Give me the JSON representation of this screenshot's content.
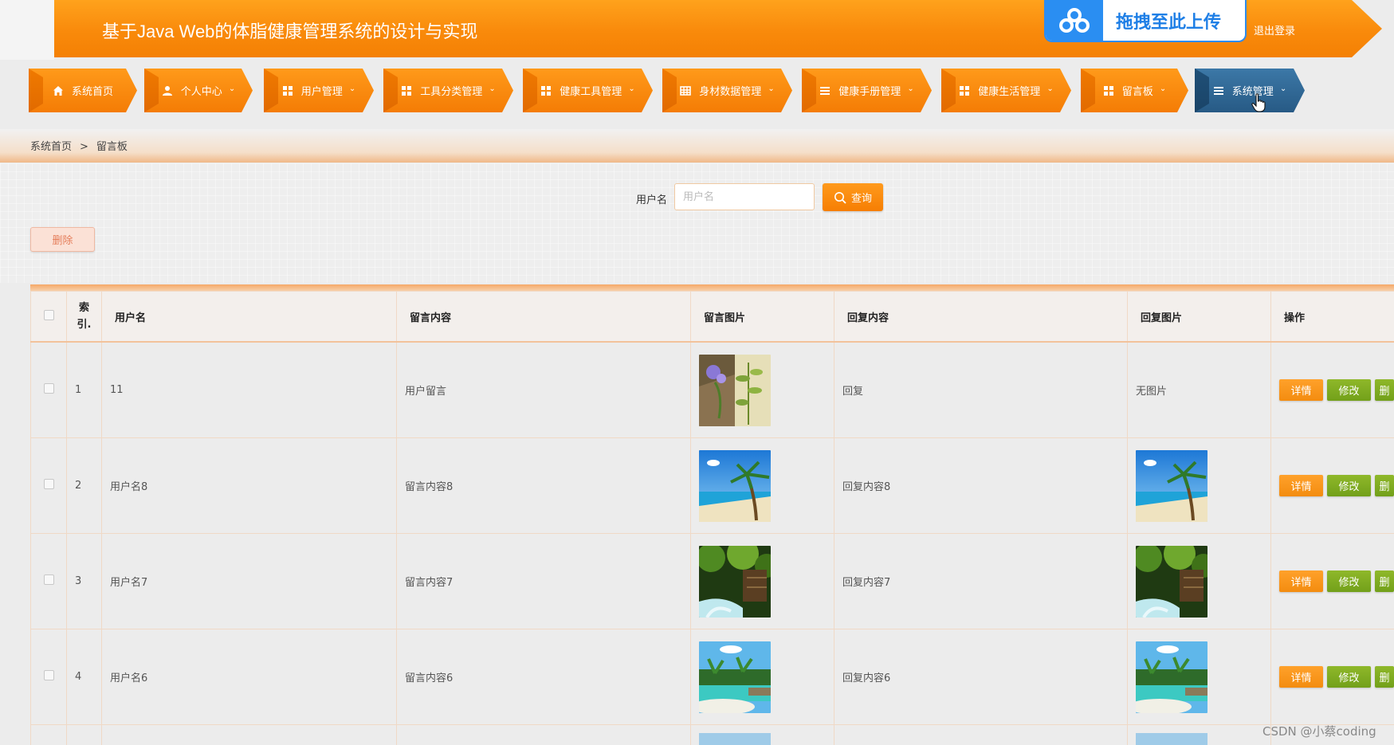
{
  "header": {
    "title": "基于Java Web的体脂健康管理系统的设计与实现",
    "upload_text": "拖拽至此上传",
    "logout": "退出登录"
  },
  "nav": {
    "items": [
      {
        "label": "系统首页",
        "icon": "home-icon",
        "dropdown": false
      },
      {
        "label": "个人中心",
        "icon": "user-icon",
        "dropdown": true
      },
      {
        "label": "用户管理",
        "icon": "grid-icon",
        "dropdown": true
      },
      {
        "label": "工具分类管理",
        "icon": "grid-icon",
        "dropdown": true
      },
      {
        "label": "健康工具管理",
        "icon": "grid-icon",
        "dropdown": true
      },
      {
        "label": "身材数据管理",
        "icon": "table-icon",
        "dropdown": true
      },
      {
        "label": "健康手册管理",
        "icon": "list-icon",
        "dropdown": true
      },
      {
        "label": "健康生活管理",
        "icon": "grid-icon",
        "dropdown": true
      },
      {
        "label": "留言板",
        "icon": "grid-icon",
        "dropdown": true
      },
      {
        "label": "系统管理",
        "icon": "list-icon",
        "dropdown": true,
        "active": true
      }
    ],
    "active_color": "#2f6a98",
    "accent_color": "#f7890a"
  },
  "breadcrumb": {
    "home": "系统首页",
    "separator": ">",
    "current": "留言板"
  },
  "search": {
    "label": "用户名",
    "placeholder": "用户名",
    "value": "",
    "button": "查询"
  },
  "toolbar": {
    "delete_label": "删除"
  },
  "table": {
    "headers": {
      "index": "索\n引.",
      "username": "用户名",
      "content": "留言内容",
      "image": "留言图片",
      "reply": "回复内容",
      "reply_image": "回复图片",
      "ops": "操作"
    },
    "rows": [
      {
        "index": "1",
        "username": "11",
        "content": "用户留言",
        "image": "flowers-photo",
        "reply": "回复",
        "reply_image_text": "无图片",
        "reply_image": ""
      },
      {
        "index": "2",
        "username": "用户名8",
        "content": "留言内容8",
        "image": "beach-palm-photo",
        "reply": "回复内容8",
        "reply_image_text": "",
        "reply_image": "beach-palm-photo"
      },
      {
        "index": "3",
        "username": "用户名7",
        "content": "留言内容7",
        "image": "waterfall-forest-photo",
        "reply": "回复内容7",
        "reply_image_text": "",
        "reply_image": "waterfall-forest-photo"
      },
      {
        "index": "4",
        "username": "用户名6",
        "content": "留言内容6",
        "image": "tropical-lagoon-photo",
        "reply": "回复内容6",
        "reply_image_text": "",
        "reply_image": "tropical-lagoon-photo"
      }
    ],
    "ops": {
      "detail": "详情",
      "edit": "修改",
      "delete": "删"
    }
  },
  "watermark": "CSDN @小蔡coding"
}
